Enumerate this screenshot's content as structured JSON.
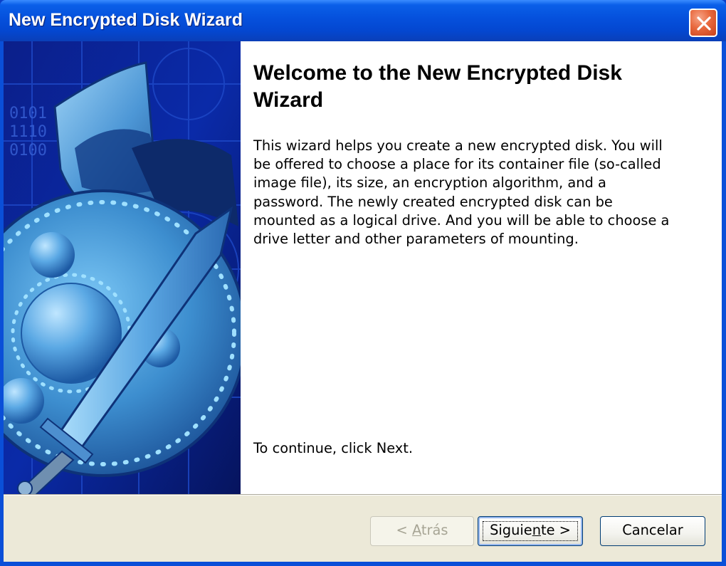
{
  "window": {
    "title": "New Encrypted Disk Wizard",
    "close_icon": "close-icon"
  },
  "wizard": {
    "heading": "Welcome to the New Encrypted Disk Wizard",
    "description": "This wizard helps you create a new encrypted disk. You will be offered to choose a place for its container file (so-called image file), its size, an encryption algorithm, and a password. The newly created encrypted disk can be mounted as a logical drive. And you will be able to choose a drive letter and other parameters of mounting.",
    "continue_hint": "To continue, click Next.",
    "banner_icon": "shield-sword-illustration"
  },
  "buttons": {
    "back_pre": "< ",
    "back_accel": "A",
    "back_post": "trás",
    "next_pre": "Siguie",
    "next_accel": "n",
    "next_post": "te >",
    "cancel": "Cancelar"
  },
  "colors": {
    "titlebar": "#0550dc",
    "client": "#ece9d8",
    "close_button": "#e8683d"
  }
}
